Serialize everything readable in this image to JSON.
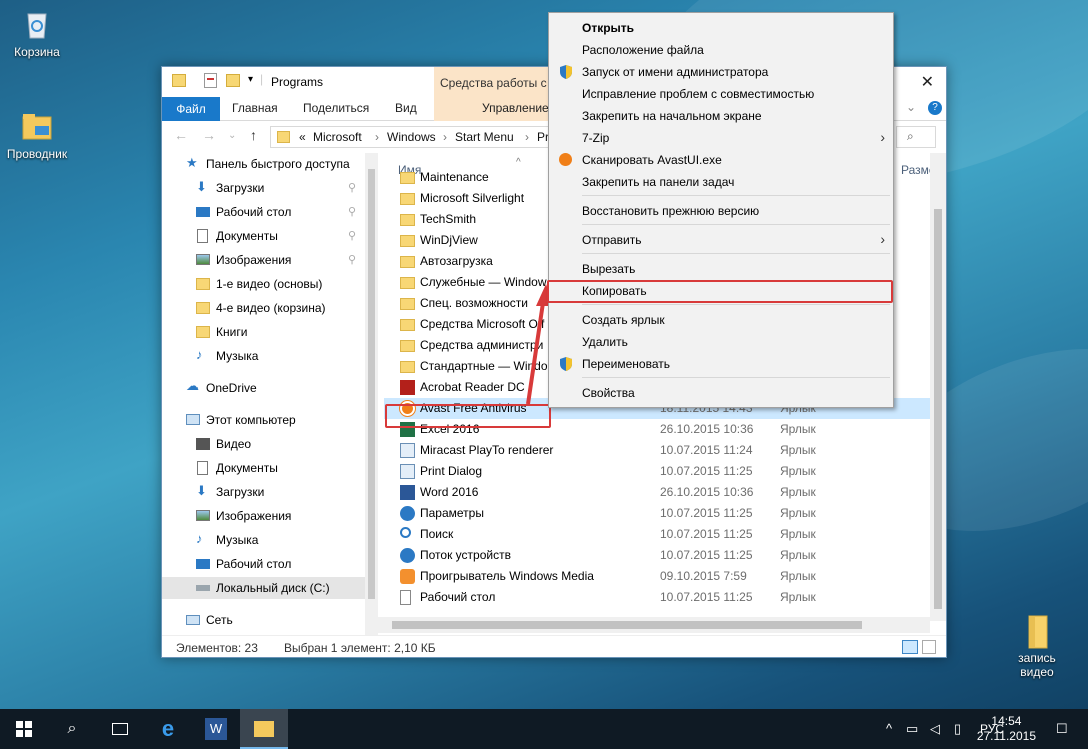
{
  "desktop": {
    "icons": [
      {
        "label": "Корзина"
      },
      {
        "label": "Проводник"
      },
      {
        "label": "запись видео"
      }
    ]
  },
  "window": {
    "title": "Programs",
    "context_tab_header": "Средства работы с яр",
    "ribbon_tabs": [
      "Файл",
      "Главная",
      "Поделиться",
      "Вид",
      "Управление"
    ],
    "address": {
      "prefix": "«",
      "crumbs": [
        "Microsoft",
        "Windows",
        "Start Menu",
        "Pr"
      ]
    },
    "nav": {
      "quick_access": "Панель быстрого доступа",
      "items": [
        {
          "label": "Загрузки",
          "pinned": true
        },
        {
          "label": "Рабочий стол",
          "pinned": true
        },
        {
          "label": "Документы",
          "pinned": true
        },
        {
          "label": "Изображения",
          "pinned": true
        },
        {
          "label": "1-е видео (основы)"
        },
        {
          "label": "4-е видео (корзина)"
        },
        {
          "label": "Книги"
        },
        {
          "label": "Музыка"
        }
      ],
      "onedrive": "OneDrive",
      "this_pc": "Этот компьютер",
      "pc_items": [
        {
          "label": "Видео"
        },
        {
          "label": "Документы"
        },
        {
          "label": "Загрузки"
        },
        {
          "label": "Изображения"
        },
        {
          "label": "Музыка"
        },
        {
          "label": "Рабочий стол"
        },
        {
          "label": "Локальный диск (C:)"
        }
      ],
      "network": "Сеть"
    },
    "list": {
      "col_name": "Имя",
      "col_size": "Разме",
      "rows": [
        {
          "name": "Maintenance",
          "date": "",
          "type": "",
          "icon": "folder"
        },
        {
          "name": "Microsoft Silverlight",
          "date": "",
          "type": "",
          "icon": "folder"
        },
        {
          "name": "TechSmith",
          "date": "",
          "type": "",
          "icon": "folder"
        },
        {
          "name": "WinDjView",
          "date": "",
          "type": "",
          "icon": "folder"
        },
        {
          "name": "Автозагрузка",
          "date": "",
          "type": "",
          "icon": "folder"
        },
        {
          "name": "Служебные — Window",
          "date": "",
          "type": "",
          "icon": "folder"
        },
        {
          "name": "Спец. возможности",
          "date": "",
          "type": "",
          "icon": "folder"
        },
        {
          "name": "Средства Microsoft Off",
          "date": "",
          "type": "",
          "icon": "folder"
        },
        {
          "name": "Средства администри",
          "date": "",
          "type": "",
          "icon": "folder"
        },
        {
          "name": "Стандартные — Windo",
          "date": "",
          "type": "",
          "icon": "folder"
        },
        {
          "name": "Acrobat Reader DC",
          "date": "",
          "type": "",
          "icon": "acrobat"
        },
        {
          "name": "Avast Free Antivirus",
          "date": "18.11.2015 14:43",
          "type": "Ярлык",
          "icon": "avast",
          "selected": true
        },
        {
          "name": "Excel 2016",
          "date": "26.10.2015 10:36",
          "type": "Ярлык",
          "icon": "excel"
        },
        {
          "name": "Miracast PlayTo renderer",
          "date": "10.07.2015 11:24",
          "type": "Ярлык",
          "icon": "app"
        },
        {
          "name": "Print Dialog",
          "date": "10.07.2015 11:25",
          "type": "Ярлык",
          "icon": "app"
        },
        {
          "name": "Word 2016",
          "date": "26.10.2015 10:36",
          "type": "Ярлык",
          "icon": "word"
        },
        {
          "name": "Параметры",
          "date": "10.07.2015 11:25",
          "type": "Ярлык",
          "icon": "gear"
        },
        {
          "name": "Поиск",
          "date": "10.07.2015 11:25",
          "type": "Ярлык",
          "icon": "search"
        },
        {
          "name": "Поток устройств",
          "date": "10.07.2015 11:25",
          "type": "Ярлык",
          "icon": "gear"
        },
        {
          "name": "Проигрыватель Windows Media",
          "date": "09.10.2015 7:59",
          "type": "Ярлык",
          "icon": "media"
        },
        {
          "name": "Рабочий стол",
          "date": "10.07.2015 11:25",
          "type": "Ярлык",
          "icon": "file"
        }
      ]
    },
    "status": {
      "count": "Элементов: 23",
      "selected": "Выбран 1 элемент: 2,10 КБ"
    }
  },
  "context_menu": {
    "items": [
      {
        "label": "Открыть",
        "bold": true
      },
      {
        "label": "Расположение файла"
      },
      {
        "label": "Запуск от имени администратора",
        "icon": "shield"
      },
      {
        "label": "Исправление проблем с совместимостью"
      },
      {
        "label": "Закрепить на начальном экране"
      },
      {
        "label": "7-Zip",
        "submenu": true
      },
      {
        "label": "Сканировать AvastUI.exe",
        "icon": "avast"
      },
      {
        "label": "Закрепить на панели задач"
      },
      {
        "label": "Восстановить прежнюю версию"
      },
      {
        "label": "Отправить",
        "submenu": true
      },
      {
        "label": "Вырезать"
      },
      {
        "label": "Копировать",
        "highlighted": true
      },
      {
        "label": "Создать ярлык"
      },
      {
        "label": "Удалить"
      },
      {
        "label": "Переименовать",
        "icon": "shield"
      },
      {
        "label": "Свойства"
      }
    ]
  },
  "taskbar": {
    "lang": "РУС",
    "time": "14:54",
    "date": "27.11.2015"
  },
  "colors": {
    "accent": "#1979ca",
    "selection": "#cce8ff",
    "highlight": "#d83a3a",
    "context_tab": "#fbe4c8"
  }
}
